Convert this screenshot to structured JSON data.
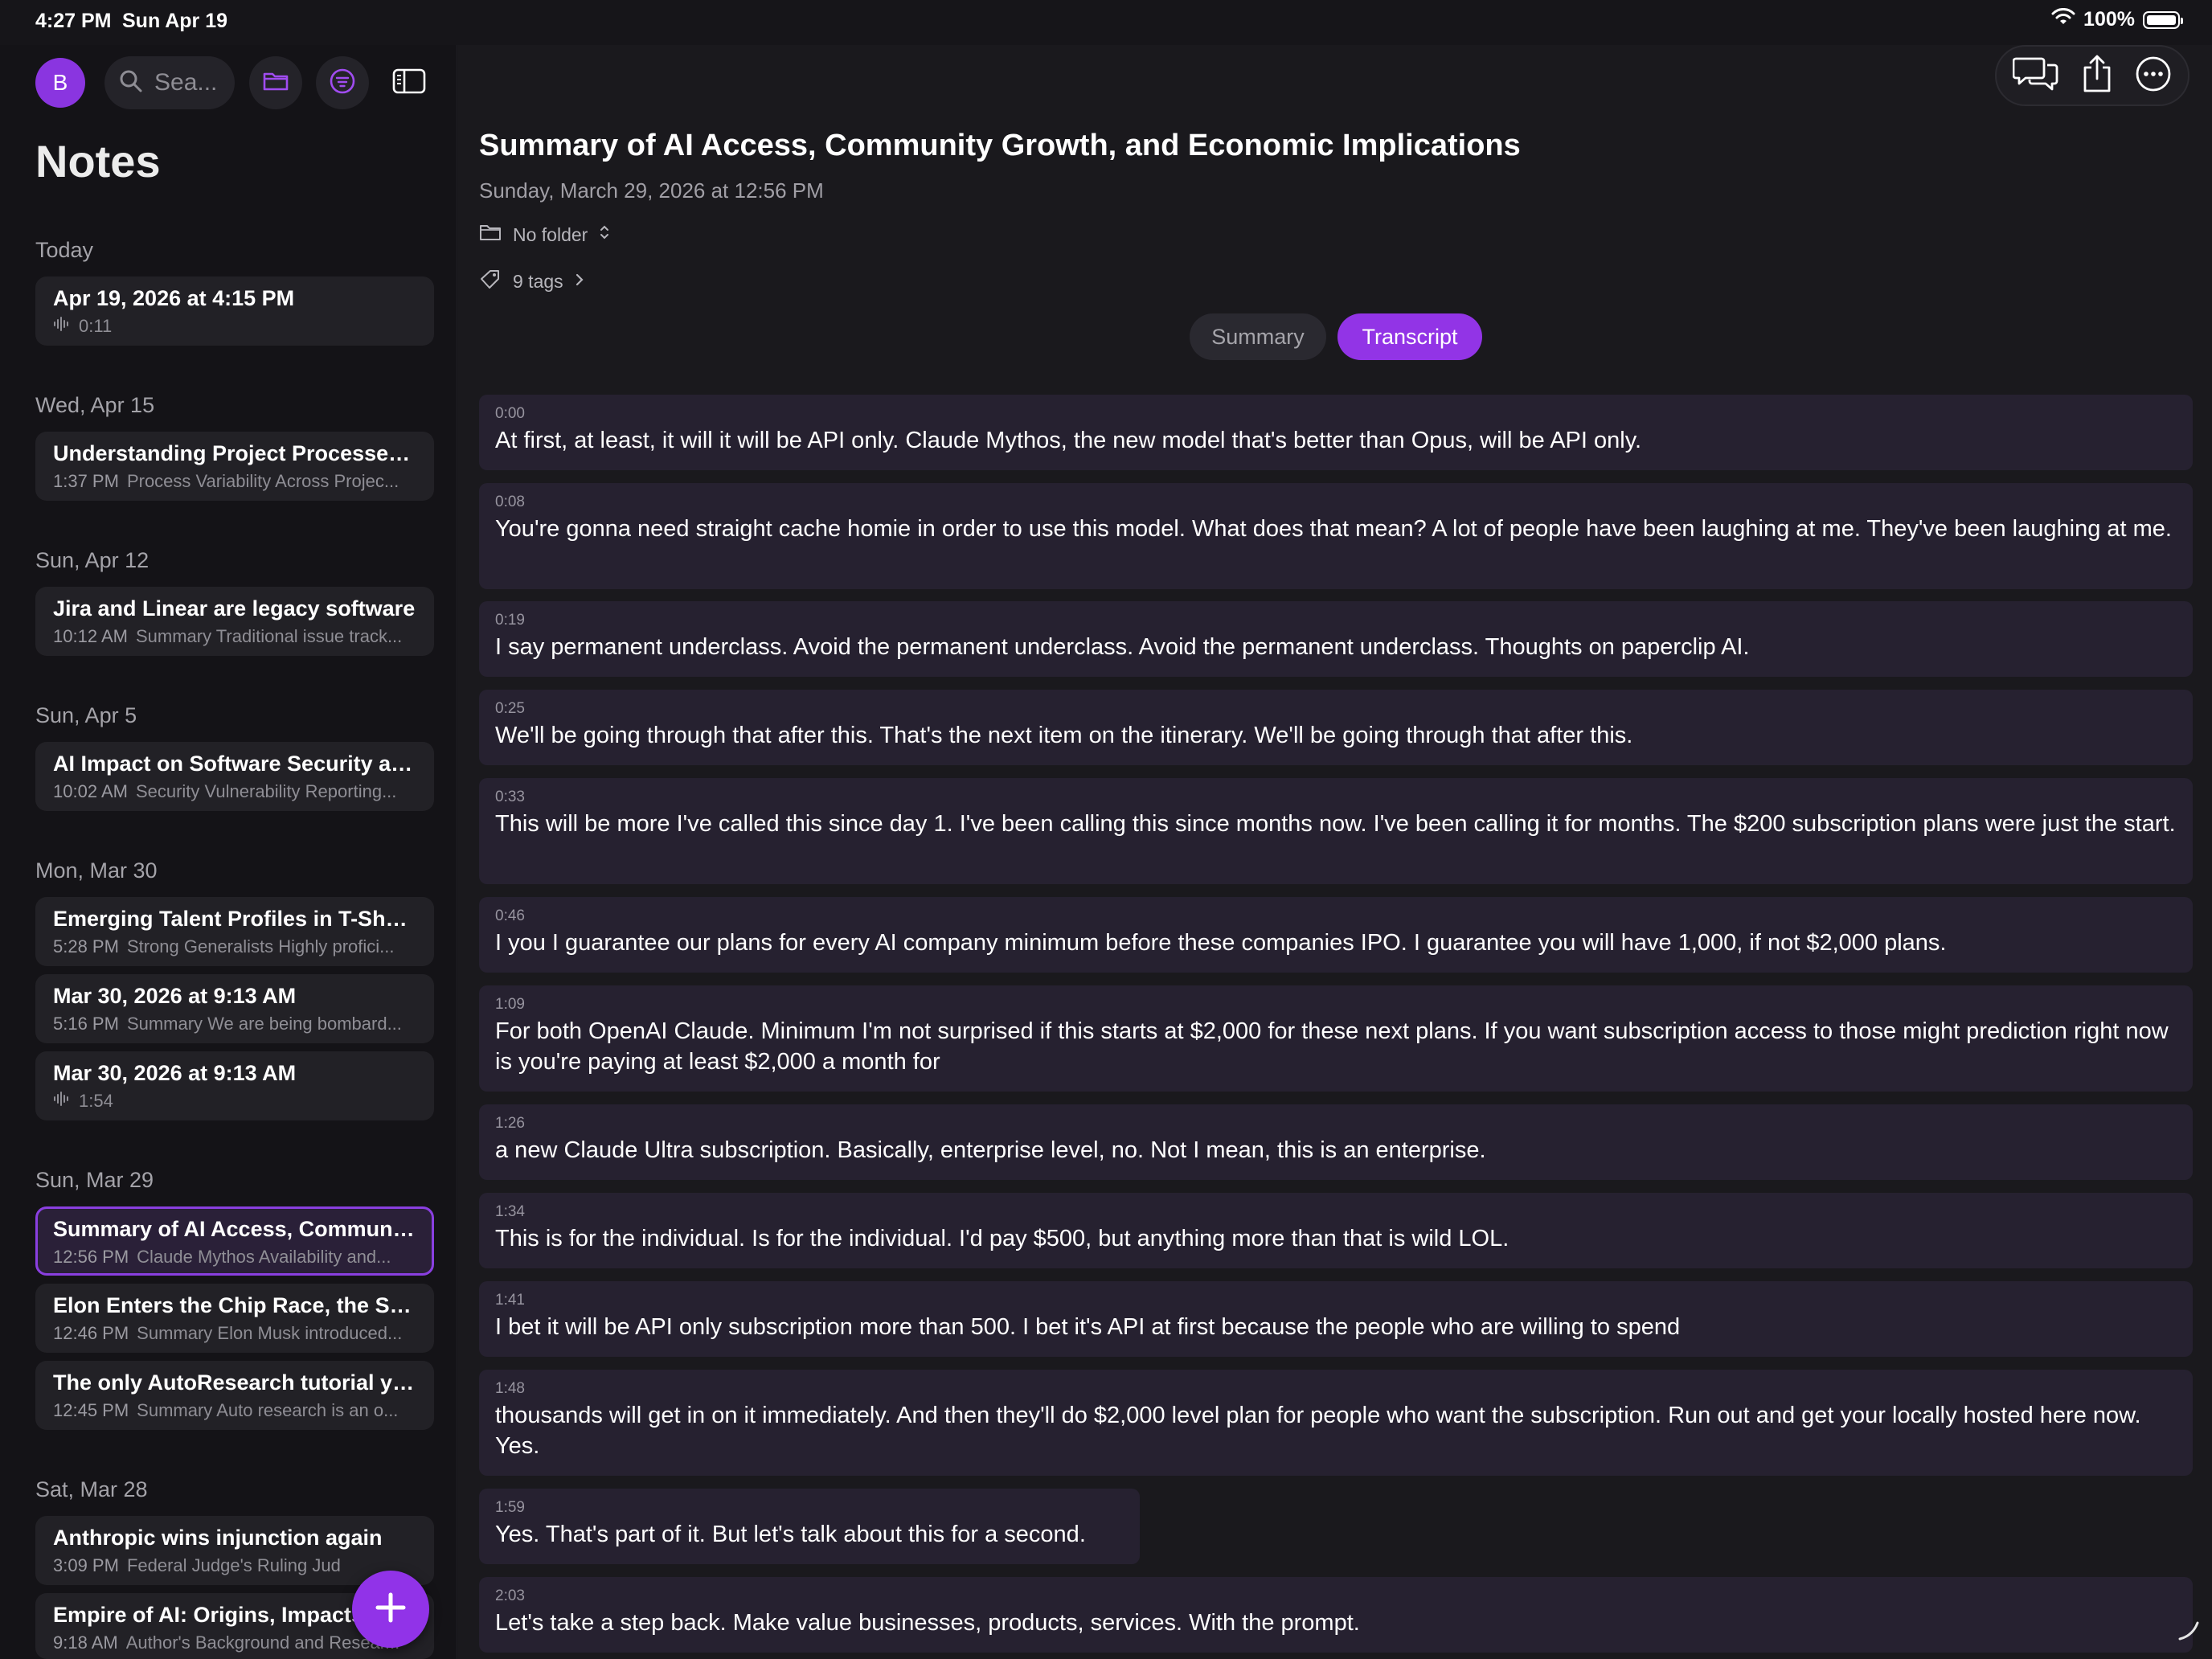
{
  "status": {
    "time": "4:27 PM",
    "date": "Sun Apr 19",
    "battery": "100%"
  },
  "sidebar": {
    "avatar_initial": "B",
    "search_placeholder": "Sea...",
    "title": "Notes",
    "sections": [
      {
        "label": "Today",
        "notes": [
          {
            "title": "Apr 19, 2026 at 4:15 PM",
            "time": "",
            "preview": "0:11",
            "audio": true
          }
        ]
      },
      {
        "label": "Wed, Apr 15",
        "notes": [
          {
            "title": "Understanding Project Processes...",
            "time": "1:37 PM",
            "preview": "Process Variability Across Projec..."
          }
        ]
      },
      {
        "label": "Sun, Apr 12",
        "notes": [
          {
            "title": "Jira and Linear are legacy software",
            "time": "10:12 AM",
            "preview": "Summary Traditional issue track..."
          }
        ]
      },
      {
        "label": "Sun, Apr 5",
        "notes": [
          {
            "title": "AI Impact on Software Security an...",
            "time": "10:02 AM",
            "preview": "Security Vulnerability Reporting..."
          }
        ]
      },
      {
        "label": "Mon, Mar 30",
        "notes": [
          {
            "title": "Emerging Talent Profiles in T-Shap...",
            "time": "5:28 PM",
            "preview": "Strong Generalists Highly profici..."
          },
          {
            "title": "Mar 30, 2026 at 9:13 AM",
            "time": "5:16 PM",
            "preview": "Summary We are being bombard..."
          },
          {
            "title": "Mar 30, 2026 at 9:13 AM",
            "time": "",
            "preview": "1:54",
            "audio": true
          }
        ]
      },
      {
        "label": "Sun, Mar 29",
        "notes": [
          {
            "title": "Summary of AI Access, Communit...",
            "time": "12:56 PM",
            "preview": "Claude Mythos Availability and...",
            "selected": true
          },
          {
            "title": "Elon Enters the Chip Race, the S&P...",
            "time": "12:46 PM",
            "preview": "Summary Elon Musk introduced..."
          },
          {
            "title": "The only AutoResearch tutorial you...",
            "time": "12:45 PM",
            "preview": "Summary Auto research is an o..."
          }
        ]
      },
      {
        "label": "Sat, Mar 28",
        "notes": [
          {
            "title": "Anthropic wins injunction again",
            "time": "3:09 PM",
            "preview": "Federal Judge's Ruling Jud"
          },
          {
            "title": "Empire of AI: Origins, Impacts, and...",
            "time": "9:18 AM",
            "preview": "Author's Background and Resear..."
          }
        ]
      }
    ]
  },
  "document": {
    "title": "Summary of AI Access, Community Growth, and Economic Implications",
    "date": "Sunday, March 29, 2026 at 12:56 PM",
    "folder": "No folder",
    "tags": "9 tags",
    "tabs": {
      "summary": "Summary",
      "transcript": "Transcript",
      "active": "Transcript"
    },
    "transcript": [
      {
        "ts": "0:00",
        "text": "At first, at least, it will it will be API only. Claude Mythos, the new model that's better than Opus, will be API only."
      },
      {
        "ts": "0:08",
        "text": "You're gonna need straight cache homie in order to use this model. What does that mean? A lot of people have been laughing at me. They've been laughing at me."
      },
      {
        "ts": "0:19",
        "text": "I say permanent underclass. Avoid the permanent underclass. Avoid the permanent underclass. Thoughts on paperclip AI."
      },
      {
        "ts": "0:25",
        "text": "We'll be going through that after this. That's the next item on the itinerary. We'll be going through that after this."
      },
      {
        "ts": "0:33",
        "text": "This will be more I've called this since day 1. I've been calling this since months now. I've been calling it for months. The $200 subscription plans were just the start."
      },
      {
        "ts": "0:46",
        "text": "I you I guarantee our plans for every AI company minimum before these companies IPO. I guarantee you will have 1,000, if not $2,000 plans."
      },
      {
        "ts": "1:09",
        "text": "For both OpenAI Claude. Minimum I'm not surprised if this starts at $2,000 for these next plans. If you want subscription access to those might prediction right now is you're paying at least $2,000 a month for"
      },
      {
        "ts": "1:26",
        "text": "a new Claude Ultra subscription. Basically, enterprise level, no. Not I mean, this is an enterprise."
      },
      {
        "ts": "1:34",
        "text": "This is for the individual. Is for the individual. I'd pay $500, but anything more than that is wild LOL."
      },
      {
        "ts": "1:41",
        "text": "I bet it will be API only subscription more than 500. I bet it's API at first because the people who are willing to spend"
      },
      {
        "ts": "1:48",
        "text": "thousands will get in on it immediately. And then they'll do $2,000 level plan for people who want the subscription. Run out and get your locally hosted here now. Yes."
      },
      {
        "ts": "1:59",
        "text": "Yes. That's part of it. But let's talk about this for a second."
      },
      {
        "ts": "2:03",
        "text": "Let's take a step back. Make value businesses, products, services. With the prompt."
      }
    ]
  },
  "colors": {
    "accent": "#9234e6",
    "background": "#1a191d",
    "sidebar": "#141317",
    "card": "#222126",
    "transcript_block": "#262130"
  },
  "icons": [
    "search-icon",
    "folder-icon",
    "filter-icon",
    "sidebar-toggle-icon",
    "chat-bubbles-icon",
    "share-icon",
    "more-icon",
    "folder-outline-icon",
    "tag-icon",
    "waveform-icon",
    "plus-icon",
    "wifi-icon",
    "battery-icon"
  ]
}
